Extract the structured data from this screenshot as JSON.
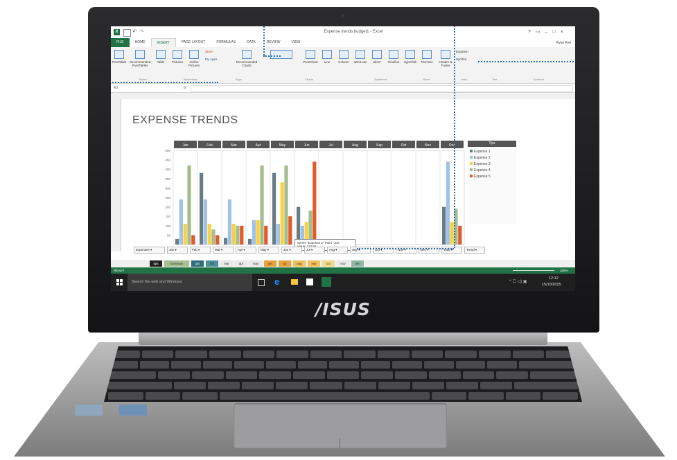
{
  "brand": {
    "name": "/ISUS"
  },
  "window": {
    "title": "Expense trends budget1 - Excel",
    "user": "Ryan Kiel"
  },
  "ribbon_tabs": [
    "FILE",
    "HOME",
    "INSERT",
    "PAGE LAYOUT",
    "FORMULAS",
    "DATA",
    "REVIEW",
    "VIEW"
  ],
  "ribbon_buttons": [
    "PivotTable",
    "Recommended PivotTables",
    "Table",
    "Pictures",
    "Online Pictures",
    "Store",
    "My Apps",
    "Recommended Charts",
    "PivotChart",
    "Line",
    "Column",
    "Win/Loss",
    "Slicer",
    "Timeline",
    "Hyperlink",
    "Text Box",
    "Header & Footer",
    "Equation",
    "Symbol"
  ],
  "ribbon_groups": [
    "Tables",
    "Illustrations",
    "Apps",
    "Charts",
    "Sparklines",
    "Filters",
    "Links",
    "Text",
    "Symbols"
  ],
  "formula_bar": {
    "cell_ref": "A3",
    "fx": "fx"
  },
  "sheet": {
    "title": "EXPENSE TRENDS"
  },
  "tips_header": "Tips",
  "tooltip": {
    "line1": "Series \"Expense 2\" Point \"Jun\"",
    "line2": "Value: 122.55"
  },
  "filter_row": [
    "Expenses",
    "Jan",
    "Feb",
    "Mar",
    "Apr",
    "May",
    "Jun",
    "Jul",
    "Aug",
    "Sep",
    "Oct",
    "Nov",
    "Dec",
    "Total",
    "Trend"
  ],
  "sheet_tabs": [
    "tips",
    "summary",
    "jan",
    "feb",
    "mar",
    "apr",
    "may",
    "jun",
    "jul",
    "aug",
    "sep",
    "oct",
    "nov",
    "dec"
  ],
  "status": {
    "left": "READY",
    "zoom": "100%"
  },
  "taskbar": {
    "search": "Search the web and Windows",
    "time": "12:12",
    "date": "15/10/2015"
  },
  "colors": {
    "excel_green": "#217346",
    "series": [
      "#6a7b86",
      "#9ec3e6",
      "#f8d045",
      "#a3bd8e",
      "#e35a2a"
    ]
  },
  "chart_data": {
    "type": "bar",
    "categories": [
      "Jan",
      "Feb",
      "Mar",
      "Apr",
      "May",
      "Jun",
      "Jul",
      "Aug",
      "Sep",
      "Oct",
      "Nov",
      "Dec"
    ],
    "ylim": [
      0,
      500
    ],
    "yticks": [
      50,
      100,
      150,
      200,
      250,
      300,
      350,
      400,
      450,
      500
    ],
    "legend": "right",
    "series": [
      {
        "name": "Expense 1",
        "color": "#6a7b86",
        "values": [
          30,
          380,
          35,
          30,
          380,
          200,
          0,
          0,
          0,
          0,
          0,
          200
        ]
      },
      {
        "name": "Expense 2",
        "color": "#9ec3e6",
        "values": [
          240,
          240,
          240,
          130,
          110,
          100,
          0,
          0,
          0,
          0,
          0,
          440
        ]
      },
      {
        "name": "Expense 3",
        "color": "#f8d045",
        "values": [
          110,
          110,
          110,
          130,
          330,
          120,
          0,
          0,
          0,
          0,
          0,
          120
        ]
      },
      {
        "name": "Expense 4",
        "color": "#a3bd8e",
        "values": [
          420,
          80,
          100,
          420,
          420,
          180,
          0,
          0,
          0,
          0,
          0,
          190
        ]
      },
      {
        "name": "Expense 5",
        "color": "#e35a2a",
        "values": [
          50,
          50,
          100,
          100,
          150,
          440,
          0,
          0,
          0,
          0,
          0,
          100
        ]
      }
    ]
  }
}
